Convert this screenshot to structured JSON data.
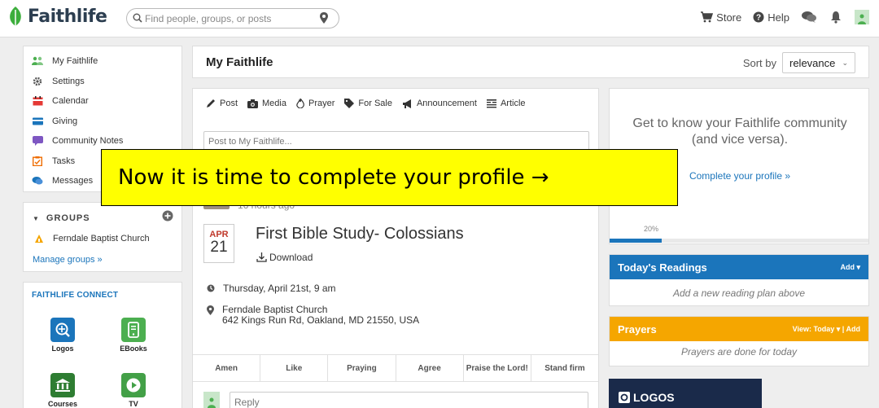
{
  "header": {
    "logo": "Faithlife",
    "search_placeholder": "Find people, groups, or posts",
    "store": "Store",
    "help": "Help"
  },
  "sidebar": {
    "items": [
      {
        "label": "My Faithlife",
        "icon": "people-icon",
        "color": "#4caf50"
      },
      {
        "label": "Settings",
        "icon": "gear-icon",
        "color": "#555555"
      },
      {
        "label": "Calendar",
        "icon": "calendar-icon",
        "color": "#e53935"
      },
      {
        "label": "Giving",
        "icon": "card-icon",
        "color": "#1b75bb"
      },
      {
        "label": "Community Notes",
        "icon": "note-icon",
        "color": "#7e57c2"
      },
      {
        "label": "Tasks",
        "icon": "tasks-icon",
        "color": "#ef6c00"
      },
      {
        "label": "Messages",
        "icon": "chat-icon",
        "color": "#1b75bb"
      }
    ]
  },
  "groups": {
    "title": "GROUPS",
    "items": [
      "Ferndale Baptist Church"
    ],
    "manage": "Manage groups »"
  },
  "connect": {
    "title": "FAITHLIFE CONNECT",
    "apps": [
      {
        "label": "Logos",
        "color": "#1b75bb"
      },
      {
        "label": "EBooks",
        "color": "#4caf50"
      },
      {
        "label": "Courses",
        "color": "#2e7d32"
      },
      {
        "label": "TV",
        "color": "#43a047"
      }
    ]
  },
  "main": {
    "title": "My Faithlife",
    "sort_label": "Sort by",
    "sort_value": "relevance",
    "post_types": [
      "Post",
      "Media",
      "Prayer",
      "For Sale",
      "Announcement",
      "Article"
    ],
    "post_placeholder": "Post to My Faithlife...",
    "time_ago": "16 hours ago",
    "event": {
      "month": "APR",
      "day": "21",
      "title": "First Bible Study- Colossians",
      "download": "Download",
      "when": "Thursday, April 21st, 9 am",
      "place": "Ferndale Baptist Church",
      "address": "642 Kings Run Rd, Oakland, MD 21550, USA"
    },
    "reactions": [
      "Amen",
      "Like",
      "Praying",
      "Agree",
      "Praise the Lord!",
      "Stand firm"
    ],
    "reply_placeholder": "Reply"
  },
  "profile": {
    "text_line1": "Get to know your Faithlife community",
    "text_line2": "(and vice versa).",
    "link": "Complete your profile »",
    "percent_label": "20%",
    "percent": 20
  },
  "readings": {
    "title": "Today's Readings",
    "action": "Add ▾",
    "body": "Add a new reading plan above",
    "color": "#1b75bb"
  },
  "prayers": {
    "title": "Prayers",
    "action": "View: Today ▾ | Add",
    "body": "Prayers are done for today",
    "color": "#f5a600"
  },
  "ad": {
    "label": "LOGOS"
  },
  "callout": {
    "text": "Now it is time to complete your profile →"
  }
}
